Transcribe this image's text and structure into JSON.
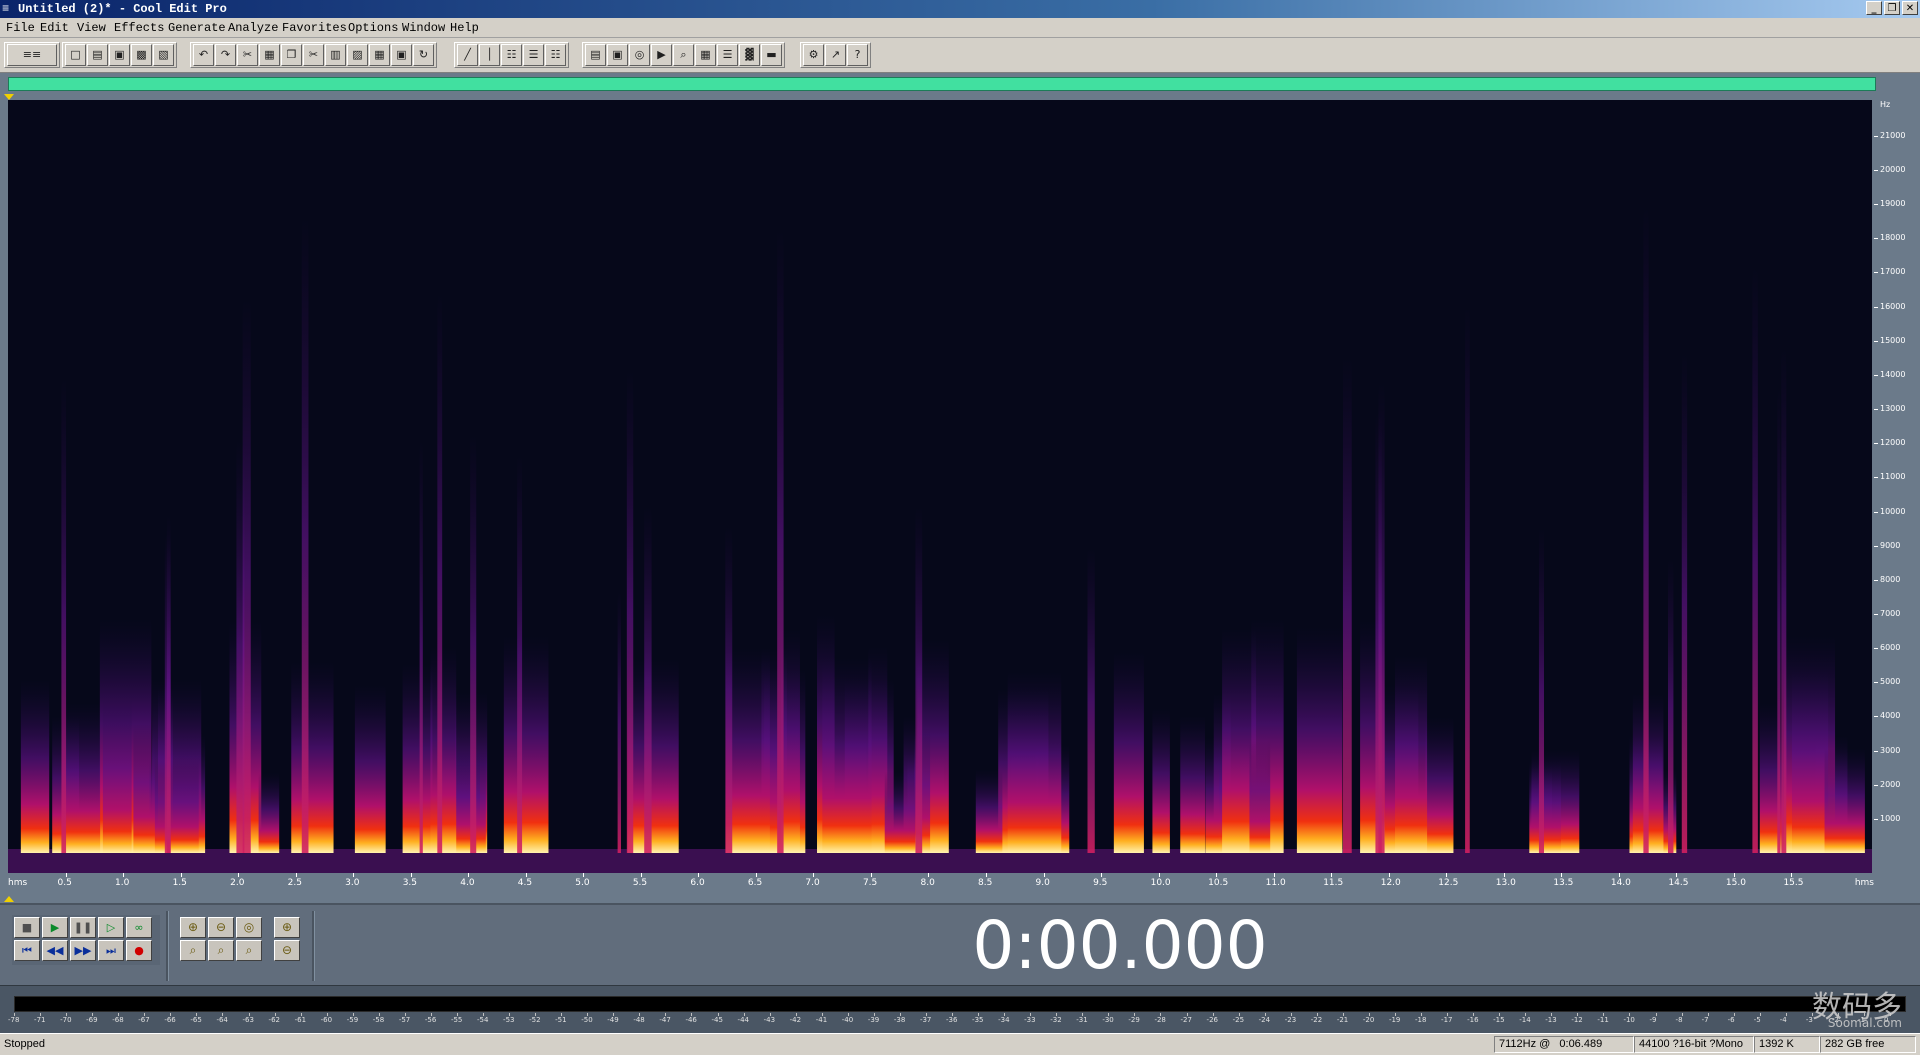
{
  "window": {
    "title": "Untitled (2)* - Cool Edit Pro",
    "app_icon": "cool-edit-icon"
  },
  "menu": [
    "File",
    "Edit",
    "View",
    "Effects",
    "Generate",
    "Analyze",
    "Favorites",
    "Options",
    "Window",
    "Help"
  ],
  "toolbar": {
    "groups": [
      [
        "multitrack-toggle-icon"
      ],
      [
        "new-icon",
        "open-icon",
        "save-icon",
        "save-as-icon",
        "close-icon"
      ],
      [
        "undo-icon",
        "redo-icon",
        "repeat-icon",
        "copy-new-icon",
        "copy-icon",
        "cut-icon",
        "paste-icon",
        "paste-new-icon",
        "mix-paste-icon",
        "trim-icon",
        "convert-icon"
      ],
      [
        "waveform-view-icon",
        "spectral-view-icon",
        "grid-icon",
        "markers-icon",
        "snap-icon"
      ],
      [
        "record-settings-icon",
        "frame-icon",
        "scripts-icon",
        "play-icon",
        "zoom-icon",
        "time-format-icon",
        "cue-list-icon",
        "level-meter-icon",
        "bar-icon"
      ],
      [
        "settings-icon",
        "help-cursor-icon",
        "help-icon"
      ]
    ]
  },
  "view": {
    "mode": "spectral",
    "hz_unit": "Hz",
    "hz_ticks": [
      21000,
      20000,
      19000,
      18000,
      17000,
      16000,
      15000,
      14000,
      13000,
      12000,
      11000,
      10000,
      9000,
      8000,
      7000,
      6000,
      5000,
      4000,
      3000,
      2000,
      1000
    ],
    "time_unit": "hms",
    "time_ticks": [
      "0.5",
      "1.0",
      "1.5",
      "2.0",
      "2.5",
      "3.0",
      "3.5",
      "4.0",
      "4.5",
      "5.0",
      "5.5",
      "6.0",
      "6.5",
      "7.0",
      "7.5",
      "8.0",
      "8.5",
      "9.0",
      "9.5",
      "10.0",
      "10.5",
      "11.0",
      "11.5",
      "12.0",
      "12.5",
      "13.0",
      "13.5",
      "14.0",
      "14.5",
      "15.0",
      "15.5"
    ],
    "overview_color": "#41e0a0",
    "background_color": "#06081a"
  },
  "transport": {
    "buttons": [
      "stop-icon",
      "play-icon",
      "pause-icon",
      "play-to-end-icon",
      "loop-icon",
      "go-to-start-icon",
      "rewind-icon",
      "fast-forward-icon",
      "go-to-end-icon",
      "record-icon"
    ]
  },
  "zoom": {
    "buttons": [
      "zoom-in-horizontal-icon",
      "zoom-out-horizontal-icon",
      "zoom-full-icon",
      "zoom-in-vertical-icon",
      "zoom-left-icon",
      "zoom-right-icon",
      "zoom-selection-icon",
      "zoom-out-vertical-icon"
    ]
  },
  "time_display": "0:00.000",
  "level_meter": {
    "labels": [
      "-78",
      "-71",
      "-70",
      "-69",
      "-68",
      "-67",
      "-66",
      "-65",
      "-64",
      "-63",
      "-62",
      "-61",
      "-60",
      "-59",
      "-58",
      "-57",
      "-56",
      "-55",
      "-54",
      "-53",
      "-52",
      "-51",
      "-50",
      "-49",
      "-48",
      "-47",
      "-46",
      "-45",
      "-44",
      "-43",
      "-42",
      "-41",
      "-40",
      "-39",
      "-38",
      "-37",
      "-36",
      "-35",
      "-34",
      "-33",
      "-32",
      "-31",
      "-30",
      "-29",
      "-28",
      "-27",
      "-26",
      "-25",
      "-24",
      "-23",
      "-22",
      "-21",
      "-20",
      "-19",
      "-18",
      "-17",
      "-16",
      "-15",
      "-14",
      "-13",
      "-12",
      "-11",
      "-10",
      "-9",
      "-8",
      "-7",
      "-6",
      "-5",
      "-4",
      "-3",
      "-2",
      "-1",
      "0"
    ]
  },
  "status": {
    "state": "Stopped",
    "cursor": "7112Hz @",
    "time": "0:06.489",
    "format": "44100 ?16-bit ?Mono",
    "size": "1392 K",
    "free": "282 GB free"
  },
  "watermark": {
    "logo": "数码多",
    "site": "Soomal.com"
  }
}
